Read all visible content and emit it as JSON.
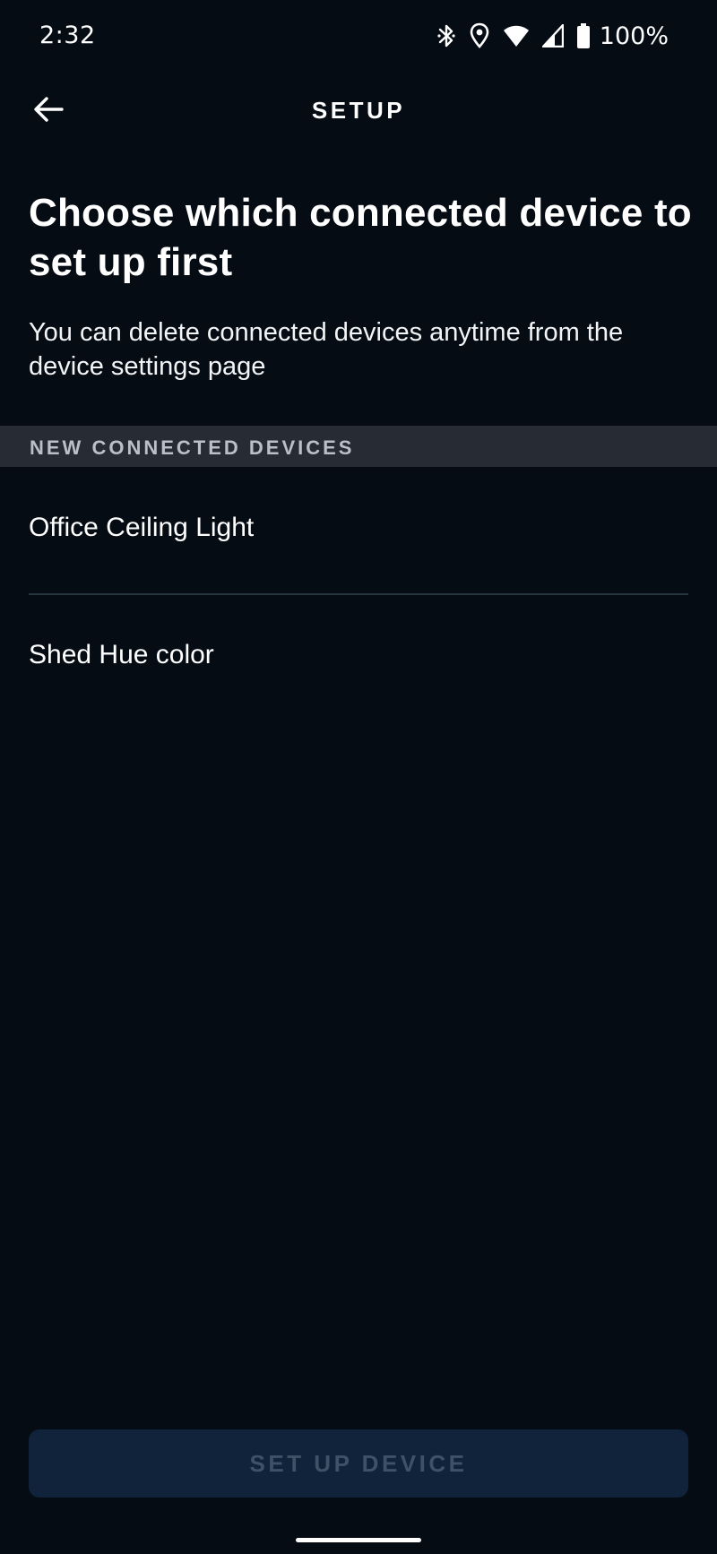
{
  "status_bar": {
    "time": "2:32",
    "battery_percent": "100%",
    "icons": [
      "bluetooth-icon",
      "location-icon",
      "wifi-icon",
      "cell-signal-icon",
      "battery-icon"
    ]
  },
  "app_bar": {
    "back_icon": "arrow-left-icon",
    "title": "SETUP"
  },
  "main": {
    "heading": "Choose which connected device to set up first",
    "subtext": "You can delete connected devices anytime from the device settings page",
    "section_title": "NEW CONNECTED DEVICES",
    "devices": [
      {
        "label": "Office Ceiling Light"
      },
      {
        "label": "Shed Hue color"
      }
    ]
  },
  "footer": {
    "setup_button_label": "SET UP DEVICE"
  },
  "colors": {
    "background": "#050c14",
    "section_header_bg": "#262b34",
    "button_bg_disabled": "#10233a",
    "button_text_disabled": "#3d5266"
  }
}
